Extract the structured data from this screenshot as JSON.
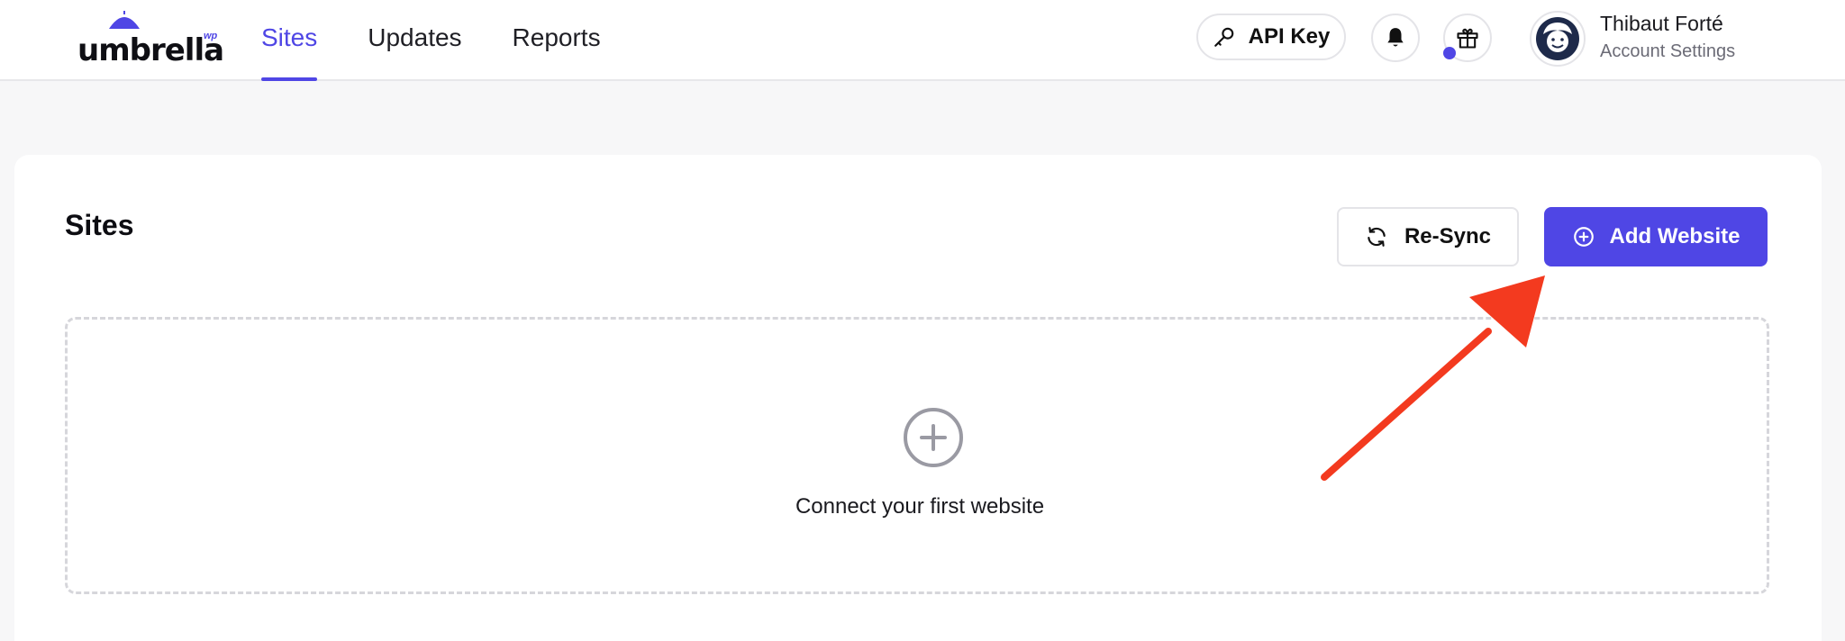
{
  "brand": {
    "name": "umbrella",
    "suffix": "wp"
  },
  "nav": {
    "items": [
      {
        "label": "Sites",
        "active": true
      },
      {
        "label": "Updates",
        "active": false
      },
      {
        "label": "Reports",
        "active": false
      }
    ]
  },
  "header": {
    "api_key_label": "API Key",
    "user": {
      "name": "Thibaut Forté",
      "subtitle": "Account Settings"
    }
  },
  "main": {
    "title": "Sites",
    "resync_label": "Re-Sync",
    "add_label": "Add Website",
    "empty_state": "Connect your first website"
  },
  "colors": {
    "accent": "#4f46e5",
    "annotation": "#f33a1f",
    "page_background": "#f7f7f8",
    "card_background": "#ffffff"
  },
  "icons": [
    "umbrella-logo-icon",
    "key-icon",
    "bell-icon",
    "gift-icon",
    "refresh-icon",
    "plus-circle-icon"
  ]
}
